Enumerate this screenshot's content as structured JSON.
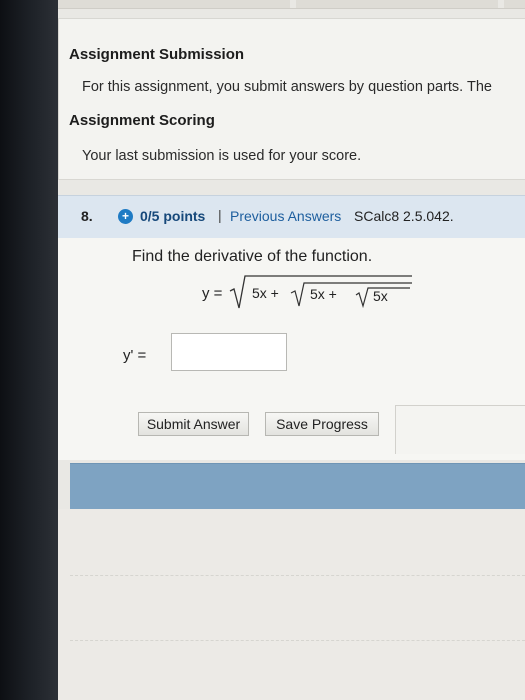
{
  "assignment_info": {
    "submission_heading": "Assignment Submission",
    "submission_text": "For this assignment, you submit answers by question parts. The",
    "scoring_heading": "Assignment Scoring",
    "scoring_text": "Your last submission is used for your score."
  },
  "question": {
    "number": "8.",
    "points": "0/5 points",
    "separator": "|",
    "previous_answers": "Previous Answers",
    "source": "SCalc8 2.5.042.",
    "prompt": "Find the derivative of the function.",
    "equation": {
      "lhs": "y =",
      "term1": "5x +",
      "term2": "5x +",
      "term3": "5x"
    },
    "answer_label": "y' =",
    "answer_value": ""
  },
  "buttons": {
    "submit": "Submit Answer",
    "save": "Save Progress"
  },
  "colors": {
    "header_bg": "#dce6f0",
    "plus_icon": "#1f7bc4",
    "link": "#1d5e9e",
    "blue_bar": "#7ea3c2"
  }
}
